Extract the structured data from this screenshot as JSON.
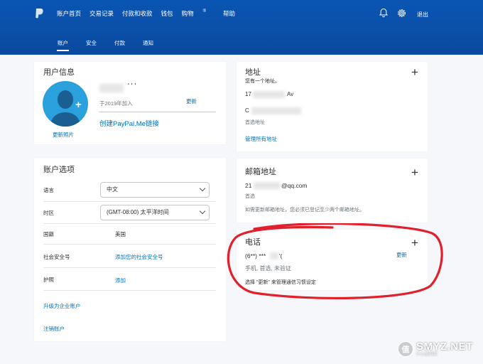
{
  "header": {
    "nav": [
      "账户首页",
      "交易记录",
      "付款和收款",
      "钱包",
      "购物",
      "帮助"
    ],
    "shopping_sup": "®",
    "logout": "退出",
    "subnav": [
      "账户",
      "安全",
      "付款",
      "通知"
    ]
  },
  "profile": {
    "title": "用户信息",
    "joined": "于2019年加入",
    "update": "更新",
    "update_photo": "更新照片",
    "paypal_me": "创建PayPal.Me链接",
    "name_partial": "' ' '"
  },
  "address": {
    "title": "地址",
    "subtitle": "您有一个地址。",
    "line1_partial": "17",
    "line1_tail": "Av",
    "line2_partial": "C",
    "primary": "首选地址",
    "manage": "管理所有地址"
  },
  "options": {
    "title": "账户选项",
    "language_label": "语言",
    "language_value": "中文",
    "timezone_label": "时区",
    "timezone_value": "(GMT-08:00) 太平洋时间",
    "nationality_label": "国籍",
    "nationality_value": "美国",
    "ssn_label": "社会安全号",
    "ssn_link": "添加您的社会安全号",
    "passport_label": "护照",
    "passport_link": "添加",
    "upgrade": "升级为企业账户",
    "close": "注销账户"
  },
  "email": {
    "title": "邮箱地址",
    "prefix": "21",
    "domain": "@qq.com",
    "primary": "首选",
    "note": "如需更新邮箱地址，您必须已登记至少两个邮箱地址。"
  },
  "phone": {
    "title": "电话",
    "number": "(6**) ***",
    "number_tail": "'(",
    "update": "更新",
    "meta": "手机, 首选, 未验证",
    "note": "选择 \"更新\" 来管理通信习惯设定"
  },
  "watermark": {
    "char": "值",
    "sub": "什么值得买",
    "site": "SMYZ.NET"
  },
  "colors": {
    "header": "#0a4aa0",
    "link": "#0070ba",
    "avatar": "#2aa0dd",
    "annotation": "#e0202a"
  }
}
